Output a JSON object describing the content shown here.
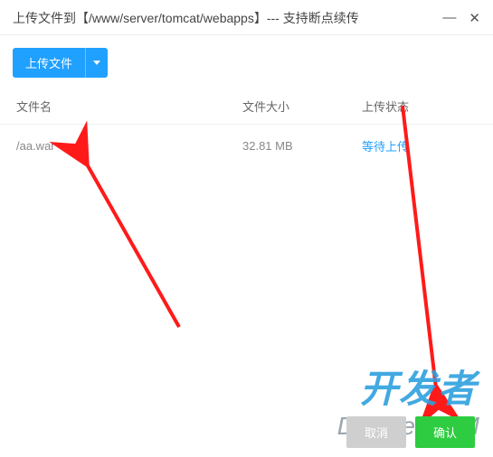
{
  "title": "上传文件到【/www/server/tomcat/webapps】--- 支持断点续传",
  "toolbar": {
    "upload_label": "上传文件"
  },
  "columns": {
    "name": "文件名",
    "size": "文件大小",
    "status": "上传状态"
  },
  "rows": [
    {
      "name": "/aa.war",
      "size": "32.81 MB",
      "status": "等待上传"
    }
  ],
  "footer": {
    "cancel": "取消",
    "confirm": "确认"
  },
  "watermark": {
    "line1": "开发者",
    "line2": "DevZe.CoM"
  }
}
